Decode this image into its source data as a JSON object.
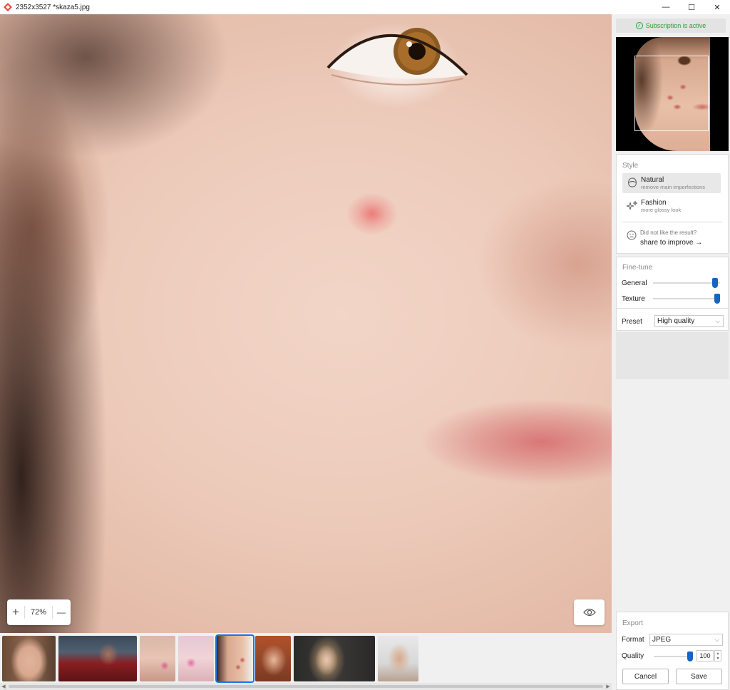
{
  "window": {
    "title": "2352x3527 *skaza5.jpg",
    "controls": {
      "minimize": "—",
      "maximize": "☐",
      "close": "✕"
    }
  },
  "canvas": {
    "zoom_in": "+",
    "zoom_value": "72%",
    "zoom_out": "—",
    "compare_icon": "eye-icon"
  },
  "filmstrip": {
    "thumbnails": [
      {
        "label": "portrait-freckles",
        "selected": false
      },
      {
        "label": "freddy-costume",
        "selected": false
      },
      {
        "label": "man-acne-1",
        "selected": false
      },
      {
        "label": "man-acne-2",
        "selected": false
      },
      {
        "label": "woman-acne",
        "selected": true
      },
      {
        "label": "redhead-smile",
        "selected": false
      },
      {
        "label": "blonde-girl",
        "selected": false
      },
      {
        "label": "man-dark-bg",
        "selected": false
      }
    ]
  },
  "panel": {
    "subscription": "Subscription is active",
    "style": {
      "title": "Style",
      "options": [
        {
          "name": "Natural",
          "desc": "remove main imperfections",
          "active": true
        },
        {
          "name": "Fashion",
          "desc": "more glossy look",
          "active": false
        }
      ],
      "feedback_question": "Did not like the result?",
      "feedback_link": "share to improve →"
    },
    "finetune": {
      "title": "Fine-tune",
      "sliders": [
        {
          "label": "General",
          "value": 0.92
        },
        {
          "label": "Texture",
          "value": 1.0
        }
      ],
      "preset_label": "Preset",
      "preset_value": "High quality"
    },
    "export": {
      "title": "Export",
      "format_label": "Format",
      "format_value": "JPEG",
      "quality_label": "Quality",
      "quality_value": "100",
      "quality_slider": 1.0,
      "cancel": "Cancel",
      "save": "Save"
    }
  },
  "colors": {
    "accent": "#1565c0",
    "selected_outline": "#1a73e8",
    "subscription_green": "#2e9b3e"
  }
}
